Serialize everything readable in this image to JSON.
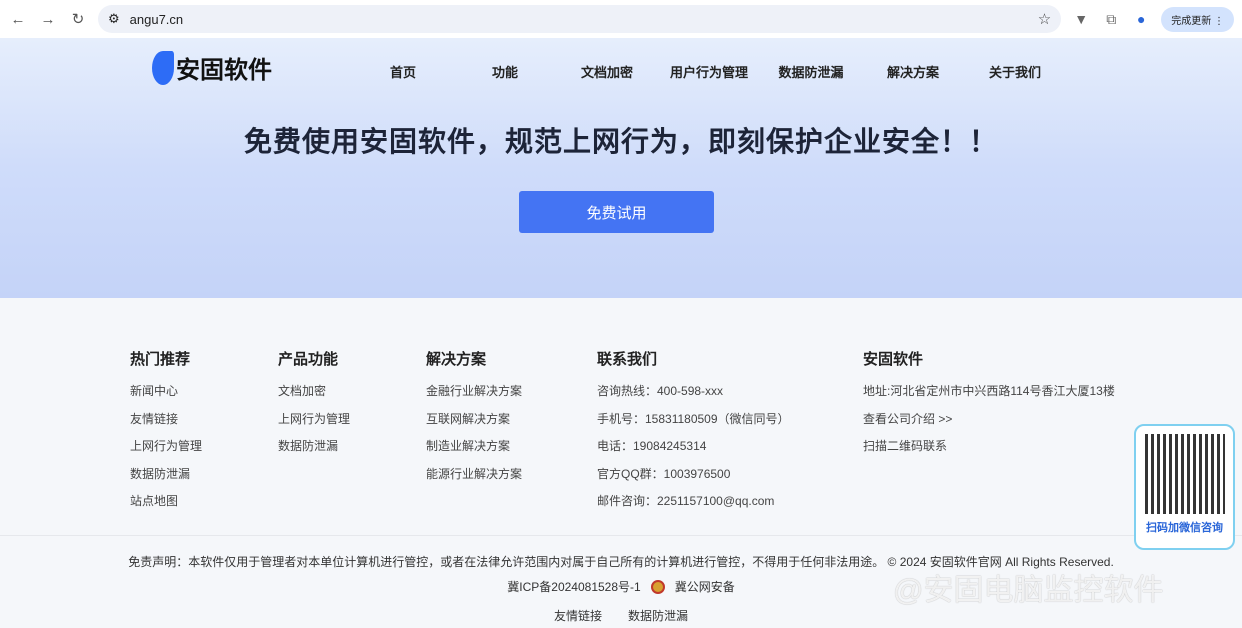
{
  "browser": {
    "url": "angu7.cn",
    "update_label": "完成更新"
  },
  "header": {
    "logo": "安固软件",
    "menu": [
      "首页",
      "功能",
      "文档加密",
      "用户行为管理",
      "数据防泄漏",
      "解决方案",
      "关于我们"
    ]
  },
  "hero": {
    "headline": "免费使用安固软件，规范上网行为，即刻保护企业安全！！",
    "cta": "免费试用"
  },
  "footer": {
    "columns": [
      {
        "title": "热门推荐",
        "items": [
          "新闻中心",
          "友情链接",
          "上网行为管理",
          "数据防泄漏",
          "站点地图"
        ]
      },
      {
        "title": "产品功能",
        "items": [
          "文档加密",
          "上网行为管理",
          "数据防泄漏"
        ]
      },
      {
        "title": "解决方案",
        "items": [
          "金融行业解决方案",
          "互联网解决方案",
          "制造业解决方案",
          "能源行业解决方案"
        ]
      },
      {
        "title": "联系我们",
        "items": [
          "咨询热线：400-598-xxx",
          "手机号：15831180509（微信同号）",
          "电话：19084245314",
          "官方QQ群：1003976500",
          "邮件咨询：2251157100@qq.com"
        ]
      },
      {
        "title": "安固软件",
        "items": [
          "地址:河北省定州市中兴西路114号香江大厦13楼",
          "查看公司介绍 >>",
          "扫描二维码联系"
        ]
      }
    ],
    "disclaimer": "免责声明：本软件仅用于管理者对本单位计算机进行管控，或者在法律允许范围内对属于自己所有的计算机进行管控，不得用于任何非法用途。 © 2024 安固软件官网 All Rights Reserved.",
    "icp": "冀ICP备2024081528号-1",
    "police": "冀公网安备",
    "links": [
      "友情链接",
      "数据防泄漏"
    ]
  },
  "qr": {
    "label": "扫码加微信咨询"
  },
  "watermark": "@安固电脑监控软件"
}
